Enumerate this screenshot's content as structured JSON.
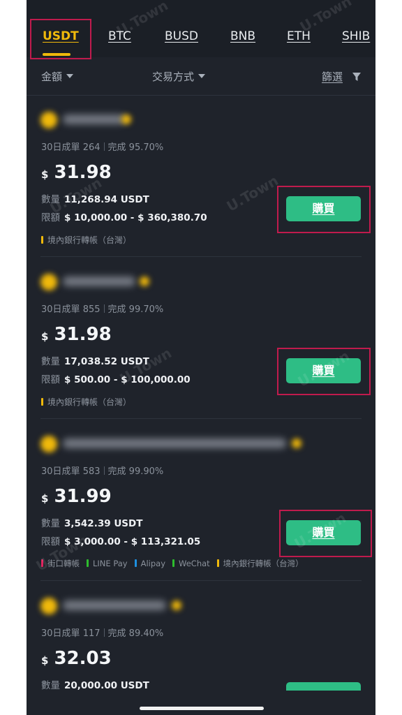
{
  "tabs": [
    {
      "label": "USDT",
      "active": true
    },
    {
      "label": "BTC",
      "active": false
    },
    {
      "label": "BUSD",
      "active": false
    },
    {
      "label": "BNB",
      "active": false
    },
    {
      "label": "ETH",
      "active": false
    },
    {
      "label": "SHIB",
      "active": false
    }
  ],
  "filters": {
    "amount": "金額",
    "payment_method": "交易方式",
    "filter": "篩選"
  },
  "watermark": "U.Town",
  "labels": {
    "orders_30d": "30日成單",
    "completion": "完成",
    "currency_symbol": "$",
    "quantity": "數量",
    "limit": "限額",
    "buy": "購買"
  },
  "colors": {
    "accent": "#f0b90b",
    "buy_button": "#2ebd85",
    "highlight_box": "#c01b4d"
  },
  "offers": [
    {
      "orders": "264",
      "completion_rate": "95.70%",
      "price": "31.98",
      "quantity": "11,268.94 USDT",
      "limit": "$ 10,000.00 - $ 360,380.70",
      "payment_methods": [
        {
          "label": "境內銀行轉帳（台灣）",
          "color": "#f0b90b"
        }
      ]
    },
    {
      "orders": "855",
      "completion_rate": "99.70%",
      "price": "31.98",
      "quantity": "17,038.52 USDT",
      "limit": "$ 500.00 - $ 100,000.00",
      "payment_methods": [
        {
          "label": "境內銀行轉帳（台灣）",
          "color": "#f0b90b"
        }
      ]
    },
    {
      "orders": "583",
      "completion_rate": "99.90%",
      "price": "31.99",
      "quantity": "3,542.39 USDT",
      "limit": "$ 3,000.00 - $ 113,321.05",
      "payment_methods": [
        {
          "label": "街口轉帳",
          "color": "#e0245e"
        },
        {
          "label": "LINE Pay",
          "color": "#2ebd2e"
        },
        {
          "label": "Alipay",
          "color": "#1e90e0"
        },
        {
          "label": "WeChat",
          "color": "#2ebd2e"
        },
        {
          "label": "境內銀行轉帳（台灣）",
          "color": "#f0b90b"
        }
      ]
    },
    {
      "orders": "117",
      "completion_rate": "89.40%",
      "price": "32.03",
      "quantity": "20,000.00 USDT"
    }
  ]
}
